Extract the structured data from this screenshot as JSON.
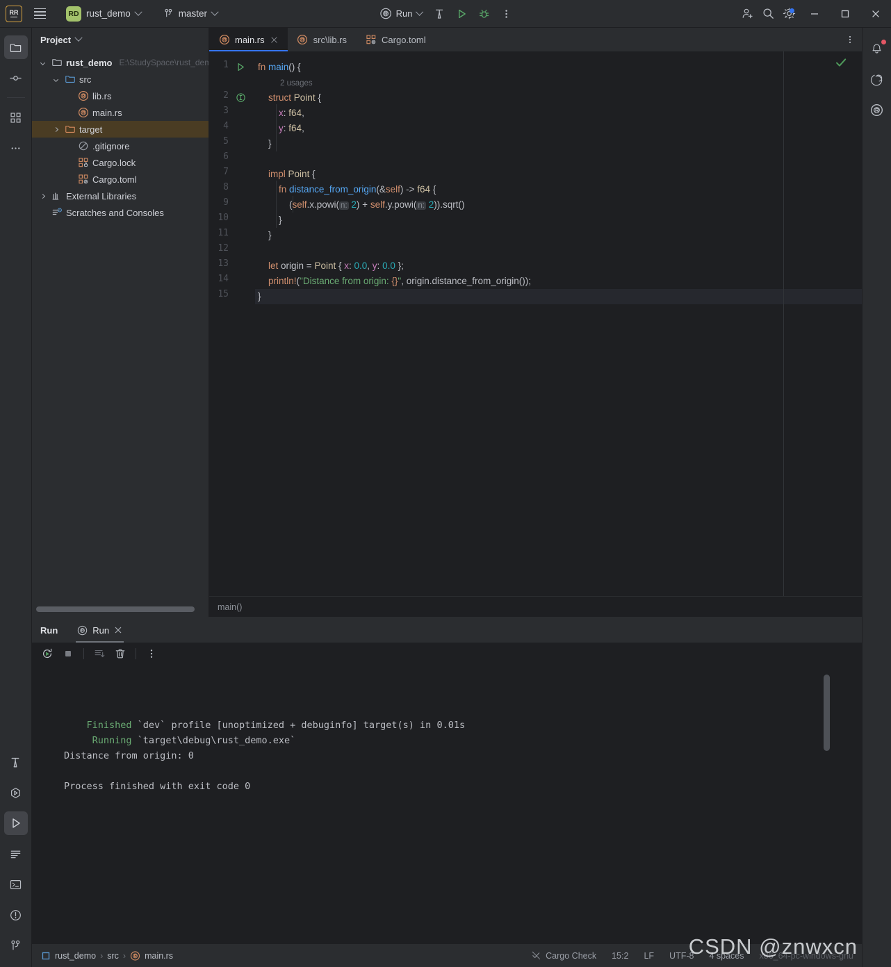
{
  "titlebar": {
    "logo_text": "RR",
    "project_badge": "RD",
    "project_name": "rust_demo",
    "branch_name": "master",
    "run_config": "Run",
    "icons": {
      "menu": "hamburger-menu-icon",
      "build": "hammer-icon",
      "run": "run-icon",
      "debug": "debug-icon",
      "more": "more-vertical-icon",
      "add_user": "add-user-icon",
      "search": "search-icon",
      "settings": "gear-icon",
      "minimize": "minimize-icon",
      "maximize": "maximize-icon",
      "close": "close-icon"
    }
  },
  "leftbar": {
    "items": [
      {
        "name": "project-tool-window",
        "icon": "folder-icon",
        "active": true
      },
      {
        "name": "commit-tool-window",
        "icon": "commit-icon",
        "active": false
      },
      {
        "name": "structure-tool-window",
        "icon": "structure-icon",
        "active": false
      },
      {
        "name": "more-tool-windows",
        "icon": "ellipsis-icon",
        "active": false
      }
    ],
    "bottom_items": [
      {
        "name": "build-tool-window",
        "icon": "hammer-icon",
        "active": false
      },
      {
        "name": "debug-tool-window",
        "icon": "debug-hexagon-icon",
        "active": false
      },
      {
        "name": "run-tool-window",
        "icon": "run-triangle-icon",
        "active": true
      },
      {
        "name": "todo-tool-window",
        "icon": "list-lines-icon",
        "active": false
      },
      {
        "name": "terminal-tool-window",
        "icon": "terminal-icon",
        "active": false
      },
      {
        "name": "problems-tool-window",
        "icon": "warning-circle-icon",
        "active": false
      },
      {
        "name": "git-tool-window",
        "icon": "git-branch-icon",
        "active": false
      }
    ]
  },
  "rightbar": {
    "items": [
      {
        "name": "notifications",
        "icon": "bell-icon",
        "badge": true
      },
      {
        "name": "ai-assistant",
        "icon": "spiral-icon",
        "badge": false
      },
      {
        "name": "rust-tool-window",
        "icon": "rust-icon",
        "badge": false
      }
    ]
  },
  "project_panel": {
    "title": "Project",
    "tree": [
      {
        "label": "rust_demo",
        "path": "E:\\StudySpace\\rust_dem",
        "icon": "folder-icon",
        "indent": 0,
        "arrow": "down",
        "bold": true,
        "selected": false
      },
      {
        "label": "src",
        "path": "",
        "icon": "src-folder-icon",
        "indent": 1,
        "arrow": "down",
        "bold": false,
        "selected": false
      },
      {
        "label": "lib.rs",
        "path": "",
        "icon": "rust-file-icon",
        "indent": 2,
        "arrow": "none",
        "bold": false,
        "selected": false
      },
      {
        "label": "main.rs",
        "path": "",
        "icon": "rust-file-icon",
        "indent": 2,
        "arrow": "none",
        "bold": false,
        "selected": false
      },
      {
        "label": "target",
        "path": "",
        "icon": "excluded-folder-icon",
        "indent": 1,
        "arrow": "right",
        "bold": false,
        "selected": true
      },
      {
        "label": ".gitignore",
        "path": "",
        "icon": "gitignore-icon",
        "indent": 2,
        "arrow": "none",
        "bold": false,
        "selected": false
      },
      {
        "label": "Cargo.lock",
        "path": "",
        "icon": "cargo-lock-icon",
        "indent": 2,
        "arrow": "none",
        "bold": false,
        "selected": false
      },
      {
        "label": "Cargo.toml",
        "path": "",
        "icon": "cargo-toml-icon",
        "indent": 2,
        "arrow": "none",
        "bold": false,
        "selected": false
      },
      {
        "label": "External Libraries",
        "path": "",
        "icon": "library-icon",
        "indent": 0,
        "arrow": "right",
        "bold": false,
        "selected": false
      },
      {
        "label": "Scratches and Consoles",
        "path": "",
        "icon": "scratches-icon",
        "indent": 0,
        "arrow": "none",
        "bold": false,
        "selected": false
      }
    ]
  },
  "editor": {
    "tabs": [
      {
        "label": "main.rs",
        "icon": "rust-file-icon",
        "active": true,
        "closable": true
      },
      {
        "label": "src\\lib.rs",
        "icon": "rust-file-icon",
        "active": false,
        "closable": false
      },
      {
        "label": "Cargo.toml",
        "icon": "cargo-toml-icon",
        "active": false,
        "closable": false
      }
    ],
    "breadcrumb": "main()",
    "inspection_status": "ok",
    "usages_hint": "2 usages",
    "gutter_marks": [
      {
        "line": 1,
        "icon": "run-gutter-icon"
      },
      {
        "line": 2,
        "icon": "implementation-gutter-icon"
      }
    ],
    "caret_line": 15,
    "lines": [
      {
        "n": 1,
        "text": "fn main() {"
      },
      {
        "n": 2,
        "text": "    struct Point {"
      },
      {
        "n": 3,
        "text": "        x: f64,"
      },
      {
        "n": 4,
        "text": "        y: f64,"
      },
      {
        "n": 5,
        "text": "    }"
      },
      {
        "n": 6,
        "text": ""
      },
      {
        "n": 7,
        "text": "    impl Point {"
      },
      {
        "n": 8,
        "text": "        fn distance_from_origin(&self) -> f64 {"
      },
      {
        "n": 9,
        "text": "            (self.x.powi( n: 2) + self.y.powi( n: 2)).sqrt()"
      },
      {
        "n": 10,
        "text": "        }"
      },
      {
        "n": 11,
        "text": "    }"
      },
      {
        "n": 12,
        "text": ""
      },
      {
        "n": 13,
        "text": "    let origin = Point { x: 0.0, y: 0.0 };"
      },
      {
        "n": 14,
        "text": "    println!(\"Distance from origin: {}\", origin.distance_from_origin());"
      },
      {
        "n": 15,
        "text": "}"
      }
    ]
  },
  "run_panel": {
    "title": "Run",
    "tab_label": "Run",
    "tab_icon": "rust-icon",
    "toolbar": [
      {
        "name": "rerun-button",
        "icon": "rerun-icon"
      },
      {
        "name": "stop-button",
        "icon": "stop-icon"
      },
      {
        "name": "scroll-to-end-button",
        "icon": "scroll-end-icon"
      },
      {
        "name": "clear-all-button",
        "icon": "trash-icon"
      },
      {
        "name": "more-options-button",
        "icon": "more-vertical-icon"
      }
    ],
    "console": [
      {
        "prefix": "    Finished",
        "rest": " `dev` profile [unoptimized + debuginfo] target(s) in 0.01s",
        "green": true
      },
      {
        "prefix": "     Running",
        "rest": " `target\\debug\\rust_demo.exe`",
        "green": true
      },
      {
        "prefix": "",
        "rest": "Distance from origin: 0",
        "green": false
      },
      {
        "prefix": "",
        "rest": "",
        "green": false
      },
      {
        "prefix": "",
        "rest": "Process finished with exit code 0",
        "green": false
      }
    ]
  },
  "status_bar": {
    "breadcrumb": [
      "rust_demo",
      "src",
      "main.rs"
    ],
    "cargo_check": "Cargo Check",
    "caret_pos": "15:2",
    "line_sep": "LF",
    "encoding": "UTF-8",
    "indent": "4 spaces",
    "toolchain": "x86_64-pc-windows-gnu",
    "watermark": "CSDN @znwxcn"
  },
  "colors": {
    "accent": "#3574F0",
    "keyword": "#CF8E6D",
    "function": "#56A8F5",
    "type": "#CDBFA3",
    "field": "#C77DBB",
    "number": "#2AACB8",
    "string": "#6AAB73",
    "selection": "#4A3C23",
    "badge_green": "#A3C26B"
  }
}
